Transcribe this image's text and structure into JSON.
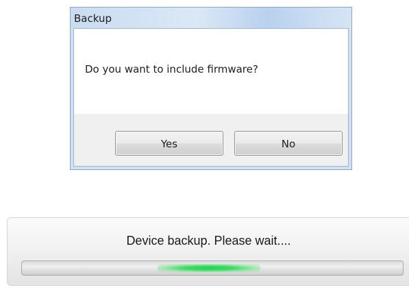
{
  "dialog": {
    "title": "Backup",
    "message": "Do you want to include firmware?",
    "buttons": {
      "yes_label": "Yes",
      "no_label": "No"
    }
  },
  "progress": {
    "message": "Device backup. Please wait....",
    "indicator_style": "indeterminate",
    "indicator_color": "#1ed34a"
  }
}
